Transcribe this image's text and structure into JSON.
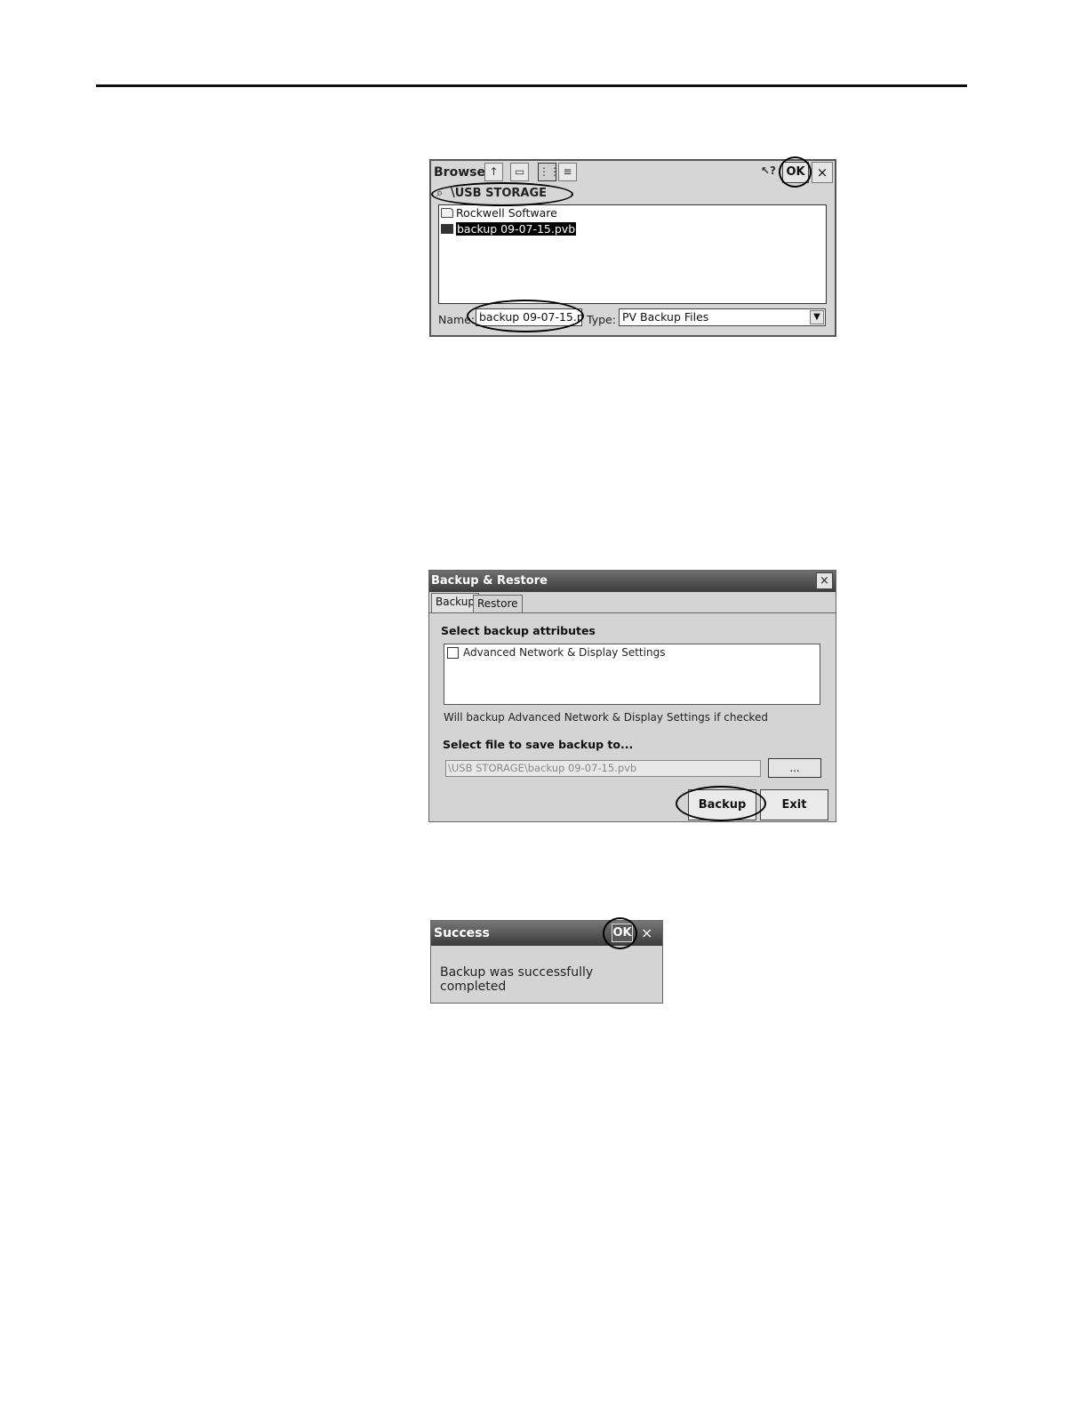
{
  "browse_dialog": {
    "title": "Browse",
    "ok_label": "OK",
    "close_label": "×",
    "path": "\\USB STORAGE",
    "files": [
      {
        "name": "Rockwell Software",
        "kind": "folder",
        "selected": false
      },
      {
        "name": "backup 09-07-15.pvb",
        "kind": "pvb-file",
        "selected": true
      }
    ],
    "name_label": "Name:",
    "name_value": "backup 09-07-15.p",
    "type_label": "Type:",
    "type_value": "PV Backup Files"
  },
  "backup_dialog": {
    "title": "Backup & Restore",
    "close_label": "×",
    "tabs": [
      {
        "label": "Backup",
        "active": true
      },
      {
        "label": "Restore",
        "active": false
      }
    ],
    "attributes_heading": "Select backup attributes",
    "attribute_option": "Advanced Network & Display Settings",
    "attribute_checked": false,
    "hint": "Will backup Advanced Network & Display Settings if checked",
    "file_heading": "Select file to save backup to...",
    "file_path": "\\USB STORAGE\\backup 09-07-15.pvb",
    "browse_label": "...",
    "backup_label": "Backup",
    "exit_label": "Exit"
  },
  "success_dialog": {
    "title": "Success",
    "ok_label": "OK",
    "close_label": "×",
    "message": "Backup was successfully completed"
  },
  "icons": [
    "up-folder-icon",
    "new-folder-icon",
    "list-view-icon",
    "details-view-icon",
    "help-cursor-icon",
    "drive-icon",
    "folder-icon",
    "pvb-file-icon",
    "dropdown-arrow-icon"
  ]
}
